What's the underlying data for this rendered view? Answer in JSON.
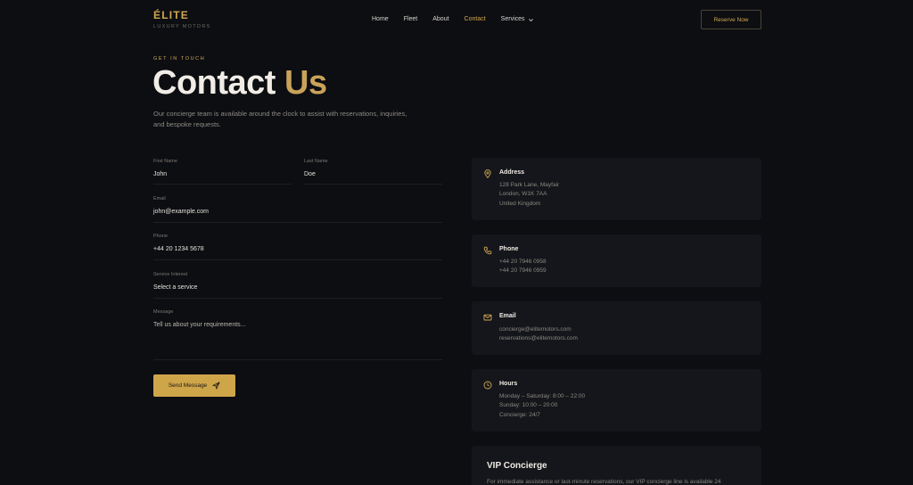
{
  "brand": {
    "name": "ÉLITE",
    "tagline": "LUXURY MOTORS"
  },
  "nav": {
    "items": [
      "Home",
      "Fleet",
      "About",
      "Contact",
      "Services"
    ],
    "active": "Contact"
  },
  "header": {
    "reserve_label": "Reserve Now"
  },
  "hero": {
    "eyebrow": "GET IN TOUCH",
    "title_main": "Contact",
    "title_accent": "Us",
    "subtitle": "Our concierge team is available around the clock to assist with reservations, inquiries, and bespoke requests."
  },
  "form": {
    "first_name": {
      "label": "First Name",
      "value": "John"
    },
    "last_name": {
      "label": "Last Name",
      "value": "Doe"
    },
    "email": {
      "label": "Email",
      "value": "john@example.com"
    },
    "phone": {
      "label": "Phone",
      "value": "+44 20 1234 5678"
    },
    "service": {
      "label": "Service Interest",
      "value": "Select a service"
    },
    "message": {
      "label": "Message",
      "placeholder": "Tell us about your requirements..."
    },
    "submit_label": "Send Message"
  },
  "contact_cards": {
    "address": {
      "title": "Address",
      "lines": [
        "128 Park Lane, Mayfair",
        "London, W1K 7AA",
        "United Kingdom"
      ],
      "icon": "map-pin-icon"
    },
    "phone": {
      "title": "Phone",
      "lines": [
        "+44 20 7946 0958",
        "+44 20 7946 0959"
      ],
      "icon": "phone-icon"
    },
    "email": {
      "title": "Email",
      "lines": [
        "concierge@elitemotors.com",
        "reservations@elitemotors.com"
      ],
      "icon": "mail-icon"
    },
    "hours": {
      "title": "Hours",
      "lines": [
        "Monday – Saturday: 8:00 – 22:00",
        "Sunday: 10:00 – 20:00",
        "Concierge: 24/7"
      ],
      "icon": "clock-icon"
    }
  },
  "vip": {
    "title": "VIP Concierge",
    "text": "For immediate assistance or last-minute reservations, our VIP concierge line is available 24"
  },
  "colors": {
    "accent": "#cfa752",
    "background": "#0d0e12",
    "card": "#15161b"
  }
}
